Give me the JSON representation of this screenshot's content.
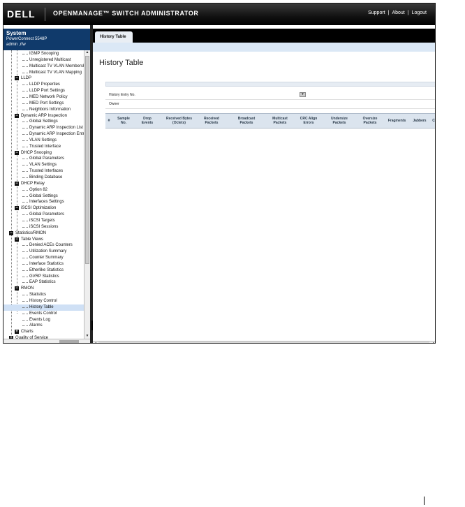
{
  "header": {
    "logo": "DELL",
    "product": "OPENMANAGE™ SWITCH ADMINISTRATOR",
    "links": [
      "Support",
      "About",
      "Logout"
    ],
    "separator": "|"
  },
  "system": {
    "title": "System",
    "model": "PowerConnect 5548P",
    "user": "admin ,rfw"
  },
  "tree": [
    {
      "label": "IGMP Snooping",
      "indent": 3,
      "partial": true
    },
    {
      "label": "Unregistered Multicast",
      "indent": 3
    },
    {
      "label": "Multicast TV VLAN Membership",
      "indent": 3
    },
    {
      "label": "Multicast TV VLAN Mapping",
      "indent": 3
    },
    {
      "label": "LLDP",
      "indent": 2,
      "toggle": "-"
    },
    {
      "label": "LLDP Properties",
      "indent": 3
    },
    {
      "label": "LLDP Port Settings",
      "indent": 3
    },
    {
      "label": "MED Network Policy",
      "indent": 3
    },
    {
      "label": "MED Port Settings",
      "indent": 3
    },
    {
      "label": "Neighbors Information",
      "indent": 3,
      "partial": true
    },
    {
      "label": "Dynamic ARP Inspection",
      "indent": 2,
      "toggle": "-"
    },
    {
      "label": "Global Settings",
      "indent": 3
    },
    {
      "label": "Dynamic ARP Inspection List",
      "indent": 3
    },
    {
      "label": "Dynamic ARP Inspection Entries",
      "indent": 3
    },
    {
      "label": "VLAN Settings",
      "indent": 3
    },
    {
      "label": "Trusted Interface",
      "indent": 3,
      "partial": true
    },
    {
      "label": "DHCP Snooping",
      "indent": 2,
      "toggle": "-"
    },
    {
      "label": "Global Parameters",
      "indent": 3
    },
    {
      "label": "VLAN Settings",
      "indent": 3
    },
    {
      "label": "Trusted Interfaces",
      "indent": 3
    },
    {
      "label": "Binding Database",
      "indent": 3
    },
    {
      "label": "DHCP Relay",
      "indent": 2,
      "toggle": "-"
    },
    {
      "label": "Option 82",
      "indent": 3
    },
    {
      "label": "Global Settings",
      "indent": 3
    },
    {
      "label": "Interfaces Settings",
      "indent": 3
    },
    {
      "label": "iSCSI Optimization",
      "indent": 2,
      "toggle": "-"
    },
    {
      "label": "Global Parameters",
      "indent": 3
    },
    {
      "label": "iSCSI Targets",
      "indent": 3
    },
    {
      "label": "iSCSI Sessions",
      "indent": 3
    },
    {
      "label": "Statistics/RMON",
      "indent": 1,
      "toggle": "-"
    },
    {
      "label": "Table Views",
      "indent": 2,
      "toggle": "-"
    },
    {
      "label": "Denied ACEs Counters",
      "indent": 3
    },
    {
      "label": "Utilization Summary",
      "indent": 3
    },
    {
      "label": "Counter Summary",
      "indent": 3
    },
    {
      "label": "Interface Statistics",
      "indent": 3
    },
    {
      "label": "Etherlike Statistics",
      "indent": 3
    },
    {
      "label": "GVRP Statistics",
      "indent": 3
    },
    {
      "label": "EAP Statistics",
      "indent": 3
    },
    {
      "label": "RMON",
      "indent": 2,
      "toggle": "-"
    },
    {
      "label": "Statistics",
      "indent": 3
    },
    {
      "label": "History Control",
      "indent": 3
    },
    {
      "label": "History Table",
      "indent": 3,
      "selected": true
    },
    {
      "label": "Events Control",
      "indent": 3
    },
    {
      "label": "Events Log",
      "indent": 3
    },
    {
      "label": "Alarms",
      "indent": 3
    },
    {
      "label": "Charts",
      "indent": 2,
      "toggle": "+"
    },
    {
      "label": "Quality of Service",
      "indent": 1,
      "toggle": "+"
    }
  ],
  "tab": {
    "label": "History Table"
  },
  "page": {
    "title": "History Table"
  },
  "form": {
    "history_entry_label": "History Entry No.",
    "owner_label": "Owner"
  },
  "table": {
    "columns": [
      "#",
      "Sample\nNo.",
      "Drop\nEvents",
      "Received Bytes\n(Octets)",
      "Received\nPackets",
      "Broadcast\nPackets",
      "Multicast\nPackets",
      "CRC Align\nErrors",
      "Undersize\nPackets",
      "Oversize\nPackets",
      "Fragments",
      "Jabbers",
      "C"
    ]
  }
}
